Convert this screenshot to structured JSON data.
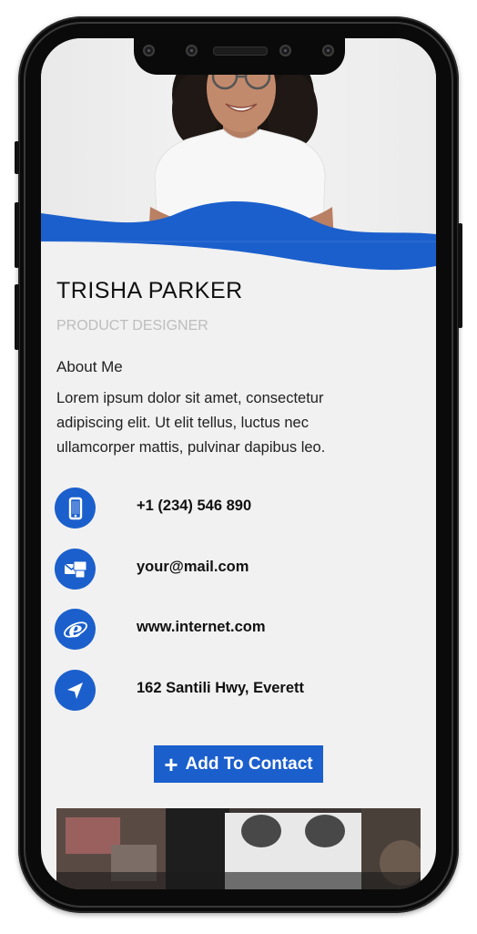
{
  "profile": {
    "name": "TRISHA PARKER",
    "title": "PRODUCT DESIGNER",
    "about_heading": "About Me",
    "about_text": "Lorem ipsum dolor sit amet, consectetur adipiscing elit. Ut elit tellus, luctus nec ullamcorper mattis, pulvinar dapibus leo."
  },
  "contacts": [
    {
      "icon": "mobile-phone-icon",
      "text": "+1 (234) 546 890"
    },
    {
      "icon": "mail-icon",
      "text": "your@mail.com"
    },
    {
      "icon": "internet-explorer-icon",
      "text": "www.internet.com"
    },
    {
      "icon": "location-arrow-icon",
      "text": "162 Santili Hwy, Everett"
    }
  ],
  "actions": {
    "add_contact_label": "Add To Contact"
  },
  "colors": {
    "accent": "#1b5fcc",
    "background": "#f1f1f1",
    "text": "#111111",
    "muted": "#bdbdbd"
  }
}
